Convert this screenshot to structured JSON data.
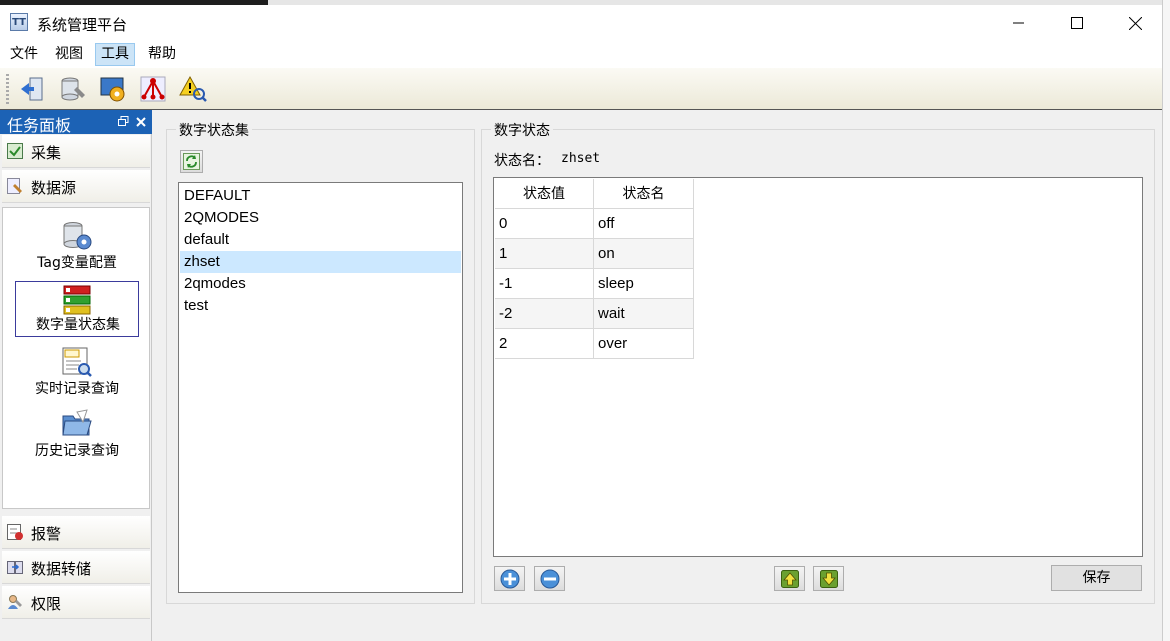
{
  "window": {
    "title": "系统管理平台"
  },
  "menu": [
    "文件",
    "视图",
    "工具",
    "帮助"
  ],
  "task_panel": {
    "title": "任务面板",
    "categories_top": [
      {
        "label": "采集",
        "icon": "collect-icon"
      },
      {
        "label": "数据源",
        "icon": "datasource-icon"
      }
    ],
    "items": [
      {
        "label": "Tag变量配置",
        "icon": "database-gear-icon"
      },
      {
        "label": "数字量状态集",
        "icon": "digital-state-icon"
      },
      {
        "label": "实时记录查询",
        "icon": "realtime-query-icon"
      },
      {
        "label": "历史记录查询",
        "icon": "history-folder-icon"
      }
    ],
    "categories_bottom": [
      {
        "label": "报警",
        "icon": "alarm-icon"
      },
      {
        "label": "数据转储",
        "icon": "data-dump-icon"
      },
      {
        "label": "权限",
        "icon": "permission-icon"
      }
    ]
  },
  "state_set": {
    "title": "数字状态集",
    "items": [
      "DEFAULT",
      "2QMODES",
      "default",
      "zhset",
      "2qmodes",
      "test"
    ],
    "selected_index": 3
  },
  "digital_state": {
    "title": "数字状态",
    "name_label": "状态名：",
    "name_value": "zhset",
    "columns": [
      "状态值",
      "状态名"
    ],
    "rows": [
      [
        "0",
        "off"
      ],
      [
        "1",
        "on"
      ],
      [
        "-1",
        "sleep"
      ],
      [
        "-2",
        "wait"
      ],
      [
        "2",
        "over"
      ]
    ],
    "save_label": "保存"
  }
}
